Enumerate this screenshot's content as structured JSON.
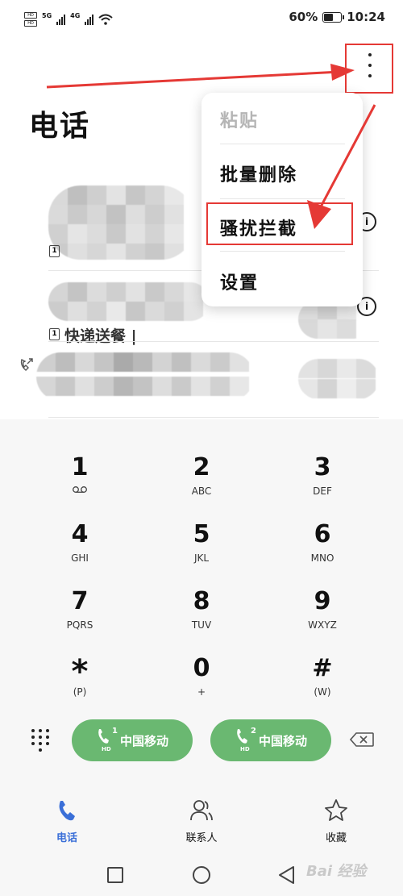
{
  "status_bar": {
    "sim1_tag": "HD",
    "sim2_tag": "HD",
    "network1": "5G",
    "network2": "4G",
    "battery_percent": "60%",
    "battery_level": 0.6,
    "time": "10:24"
  },
  "header": {
    "title": "电话"
  },
  "call_log": {
    "rows": [
      {
        "name": "",
        "sim": "1",
        "detail": ""
      },
      {
        "name": "",
        "sim": "1",
        "detail": "快递送餐 |"
      },
      {
        "name": "",
        "sim": "",
        "detail": ""
      }
    ]
  },
  "menu": {
    "items": [
      {
        "label": "粘贴",
        "enabled": false
      },
      {
        "label": "批量删除",
        "enabled": true
      },
      {
        "label": "骚扰拦截",
        "enabled": true
      },
      {
        "label": "设置",
        "enabled": true
      }
    ]
  },
  "dialpad": {
    "keys": [
      {
        "digit": "1",
        "letters": ""
      },
      {
        "digit": "2",
        "letters": "ABC"
      },
      {
        "digit": "3",
        "letters": "DEF"
      },
      {
        "digit": "4",
        "letters": "GHI"
      },
      {
        "digit": "5",
        "letters": "JKL"
      },
      {
        "digit": "6",
        "letters": "MNO"
      },
      {
        "digit": "7",
        "letters": "PQRS"
      },
      {
        "digit": "8",
        "letters": "TUV"
      },
      {
        "digit": "9",
        "letters": "WXYZ"
      },
      {
        "digit": "*",
        "letters": "(P)"
      },
      {
        "digit": "0",
        "letters": "+"
      },
      {
        "digit": "#",
        "letters": "(W)"
      }
    ],
    "voicemail_icon": "voicemail-icon"
  },
  "call_buttons": [
    {
      "sim": "1",
      "hd": "HD",
      "label": "中国移动"
    },
    {
      "sim": "2",
      "hd": "HD",
      "label": "中国移动"
    }
  ],
  "nav": {
    "tabs": [
      {
        "label": "电话",
        "icon": "phone-icon",
        "active": true
      },
      {
        "label": "联系人",
        "icon": "contacts-icon",
        "active": false
      },
      {
        "label": "收藏",
        "icon": "star-icon",
        "active": false
      }
    ]
  },
  "watermark": "Bai 经验",
  "colors": {
    "accent": "#3a6fd8",
    "call_green": "#6ab871",
    "annotation_red": "#e53935"
  }
}
